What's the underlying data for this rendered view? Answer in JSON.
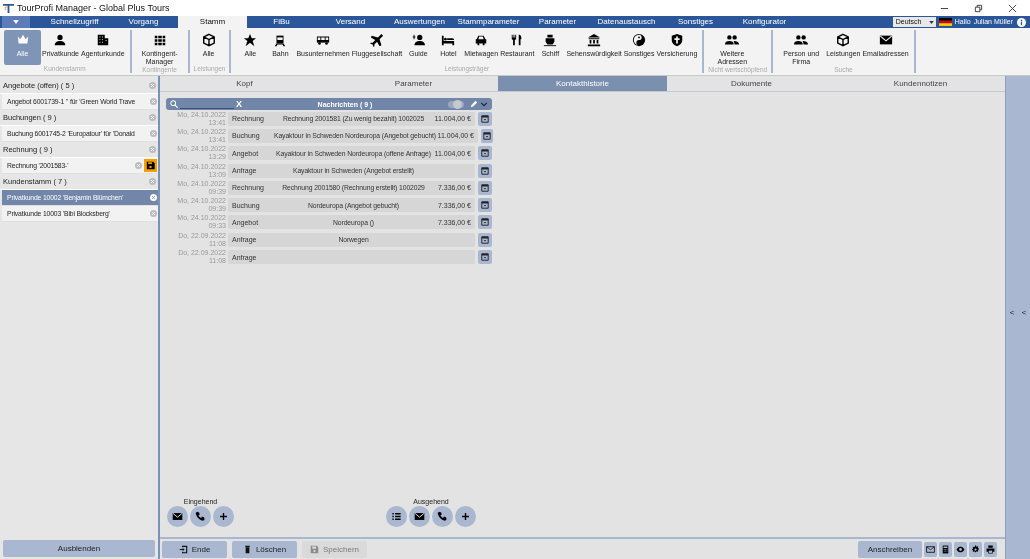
{
  "window": {
    "title": "TourProfi Manager -  Global Plus Tours"
  },
  "menu_tabs": [
    {
      "label": "Schnellzugriff",
      "selected": false
    },
    {
      "label": "Vorgang",
      "selected": false
    },
    {
      "label": "Stamm",
      "selected": true
    },
    {
      "label": "FiBu",
      "selected": false
    },
    {
      "label": "Versand",
      "selected": false
    },
    {
      "label": "Auswertungen",
      "selected": false
    },
    {
      "label": "Stammparameter",
      "selected": false
    },
    {
      "label": "Parameter",
      "selected": false
    },
    {
      "label": "Datenaustausch",
      "selected": false
    },
    {
      "label": "Sonstiges",
      "selected": false
    },
    {
      "label": "Konfigurator",
      "selected": false
    }
  ],
  "user_bar": {
    "language": "Deutsch",
    "greeting": "Hallo",
    "user": "Julian Müller"
  },
  "ribbon_groups": [
    {
      "label": "Kundenstamm",
      "items": [
        {
          "label": "Alle",
          "selected": true
        },
        {
          "label": "Privatkunde",
          "selected": false
        },
        {
          "label": "Agenturkunde",
          "selected": false
        }
      ]
    },
    {
      "label": "Kontingente",
      "items": [
        {
          "label": "Kontingent-Manager",
          "selected": false
        }
      ]
    },
    {
      "label": "Leistungen",
      "items": [
        {
          "label": "Alle",
          "selected": false
        }
      ]
    },
    {
      "label": "Leistungsträger",
      "items": [
        {
          "label": "Alle",
          "selected": false
        },
        {
          "label": "Bahn",
          "selected": false
        },
        {
          "label": "Busunternehmen",
          "selected": false
        },
        {
          "label": "Fluggesellschaft",
          "selected": false
        },
        {
          "label": "Guide",
          "selected": false
        },
        {
          "label": "Hotel",
          "selected": false
        },
        {
          "label": "Mietwagen",
          "selected": false
        },
        {
          "label": "Restaurant",
          "selected": false
        },
        {
          "label": "Schiff",
          "selected": false
        },
        {
          "label": "Sehenswürdigkeit",
          "selected": false
        },
        {
          "label": "Sonstiges",
          "selected": false
        },
        {
          "label": "Versicherung",
          "selected": false
        }
      ]
    },
    {
      "label": "Nicht wertschöpfend",
      "items": [
        {
          "label": "Weitere Adressen",
          "selected": false
        }
      ]
    },
    {
      "label": "Suche",
      "items": [
        {
          "label": "Person und Firma",
          "selected": false
        },
        {
          "label": "Leistungen",
          "selected": false
        },
        {
          "label": "Emailadressen",
          "selected": false
        }
      ]
    }
  ],
  "sidebar": {
    "sections": [
      {
        "title": "Angebote (offen) ( 5 )",
        "items": [
          {
            "label": "Angebot 6001739-1 '' für 'Green World Trave",
            "selected": false,
            "unsaved": false
          }
        ]
      },
      {
        "title": "Buchungen ( 9 )",
        "items": [
          {
            "label": "Buchung 6001745-2 'Europatour' für 'Donald",
            "selected": false,
            "unsaved": false
          }
        ]
      },
      {
        "title": "Rechnung ( 9 )",
        "items": [
          {
            "label": "Rechnung '2001583-'",
            "selected": false,
            "unsaved": true
          }
        ]
      },
      {
        "title": "Kundenstamm ( 7 )",
        "items": [
          {
            "label": "Privatkunde 10002 'Benjamin Blümchen'",
            "selected": true,
            "unsaved": false
          },
          {
            "label": "Privatkunde 10003 'Bibi Blocksberg'",
            "selected": false,
            "unsaved": false
          }
        ]
      }
    ],
    "hide_button": "Ausblenden"
  },
  "content_tabs": [
    {
      "label": "Kopf",
      "selected": false
    },
    {
      "label": "Parameter",
      "selected": false
    },
    {
      "label": "Kontakthistorie",
      "selected": true
    },
    {
      "label": "Dokumente",
      "selected": false
    },
    {
      "label": "Kundennotizen",
      "selected": false
    }
  ],
  "messages": {
    "title": "Nachrichten ( 9 )",
    "clear": "X",
    "toggle_on": false,
    "rows": [
      {
        "date": "Mo, 24.10.2022",
        "time": "13:41",
        "type": "Rechnung",
        "subject": "Rechnung 2001581 (Zu wenig bezahlt) 1002025",
        "amount": "11.004,00 €"
      },
      {
        "date": "Mo, 24.10.2022",
        "time": "13:41",
        "type": "Buchung",
        "subject": "Kayaktour in Schweden Nordeuropa (Angebot gebucht)",
        "amount": "11.004,00 €"
      },
      {
        "date": "Mo, 24.10.2022",
        "time": "13:29",
        "type": "Angebot",
        "subject": "Kayaktour in Schweden Nordeuropa (offene Anfrage)",
        "amount": "11.004,00 €"
      },
      {
        "date": "Mo, 24.10.2022",
        "time": "13:09",
        "type": "Anfrage",
        "subject": "Kayaktour in Schweden (Angebot erstellt)"
      },
      {
        "date": "Mo, 24.10.2022",
        "time": "09:39",
        "type": "Rechnung",
        "subject": "Rechnung 2001580 (Rechnung erstellt) 1002029",
        "amount": "7.336,00 €"
      },
      {
        "date": "Mo, 24.10.2022",
        "time": "09:39",
        "type": "Buchung",
        "subject": "Nordeuropa (Angebot gebucht)",
        "amount": "7.336,00 €"
      },
      {
        "date": "Mo, 24.10.2022",
        "time": "09:33",
        "type": "Angebot",
        "subject": "Nordeuropa ()",
        "amount": "7.336,00 €"
      },
      {
        "date": "Do, 22.09.2022",
        "time": "11:08",
        "type": "Anfrage",
        "subject": "Norwegen"
      },
      {
        "date": "Do, 22.09.2022",
        "time": "11:08",
        "type": "Anfrage"
      }
    ]
  },
  "incoming": {
    "label": "Eingehend"
  },
  "outgoing": {
    "label": "Ausgehend"
  },
  "footer": {
    "buttons": [
      {
        "label": "Ende",
        "disabled": false
      },
      {
        "label": "Löschen",
        "disabled": false
      },
      {
        "label": "Speichern",
        "disabled": true
      }
    ],
    "write_button": "Anschreiben"
  },
  "side_strip": [
    "<",
    "<"
  ]
}
